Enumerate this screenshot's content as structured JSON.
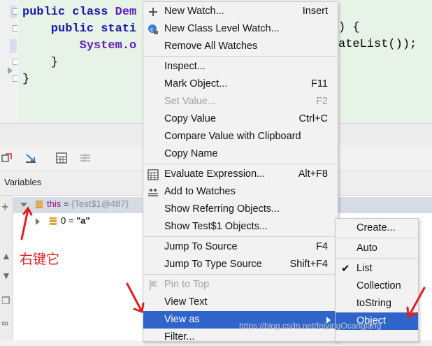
{
  "editor": {
    "code_lines": [
      [
        "public class ",
        "Dem"
      ],
      [
        "    public stati",
        ""
      ],
      [
        "        ",
        "System",
        ".",
        "o"
      ],
      [
        "    }"
      ],
      [
        "}"
      ]
    ],
    "line2_tail": ") {",
    "line3_tail": "ateList());"
  },
  "debugger": {
    "variables_title": "Variables",
    "rows": [
      {
        "name": "this",
        "eq": " = ",
        "value": "{Test$1@487}"
      },
      {
        "name": "0",
        "eq": " = ",
        "value": "\"a\""
      }
    ]
  },
  "annotation": {
    "right_click_note": "右键它"
  },
  "context_menu": {
    "items": [
      {
        "label": "New Watch...",
        "shortcut": "Insert",
        "icon": "plus-icon"
      },
      {
        "label": "New Class Level Watch...",
        "shortcut": "",
        "icon": "class-watch-icon"
      },
      {
        "label": "Remove All Watches",
        "shortcut": ""
      },
      {
        "label": "Inspect...",
        "shortcut": ""
      },
      {
        "label": "Mark Object...",
        "shortcut": "F11"
      },
      {
        "label": "Set Value...",
        "shortcut": "F2"
      },
      {
        "label": "Copy Value",
        "shortcut": "Ctrl+C"
      },
      {
        "label": "Compare Value with Clipboard",
        "shortcut": ""
      },
      {
        "label": "Copy Name",
        "shortcut": ""
      },
      {
        "label": "Evaluate Expression...",
        "shortcut": "Alt+F8",
        "icon": "calculator-icon"
      },
      {
        "label": "Add to Watches",
        "shortcut": "",
        "icon": "add-watches-icon"
      },
      {
        "label": "Show Referring Objects...",
        "shortcut": ""
      },
      {
        "label": "Show Test$1 Objects...",
        "shortcut": ""
      },
      {
        "label": "Jump To Source",
        "shortcut": "F4"
      },
      {
        "label": "Jump To Type Source",
        "shortcut": "Shift+F4"
      },
      {
        "label": "Pin to Top",
        "shortcut": "",
        "icon": "pin-icon"
      },
      {
        "label": "View Text",
        "shortcut": ""
      },
      {
        "label": "View as",
        "shortcut": ""
      },
      {
        "label": "Filter...",
        "shortcut": ""
      }
    ]
  },
  "view_as_submenu": {
    "items": [
      {
        "label": "Create..."
      },
      {
        "label": "Auto"
      },
      {
        "label": "List",
        "checked": "✔"
      },
      {
        "label": "Collection"
      },
      {
        "label": "toString"
      },
      {
        "label": "Object"
      }
    ]
  },
  "watermark": "https://blog.csdn.net/feiyingOcanglang",
  "colors": {
    "highlight": "#2f65ca",
    "menu_bg": "#f2f2f2",
    "annotation_red": "#e02020"
  }
}
